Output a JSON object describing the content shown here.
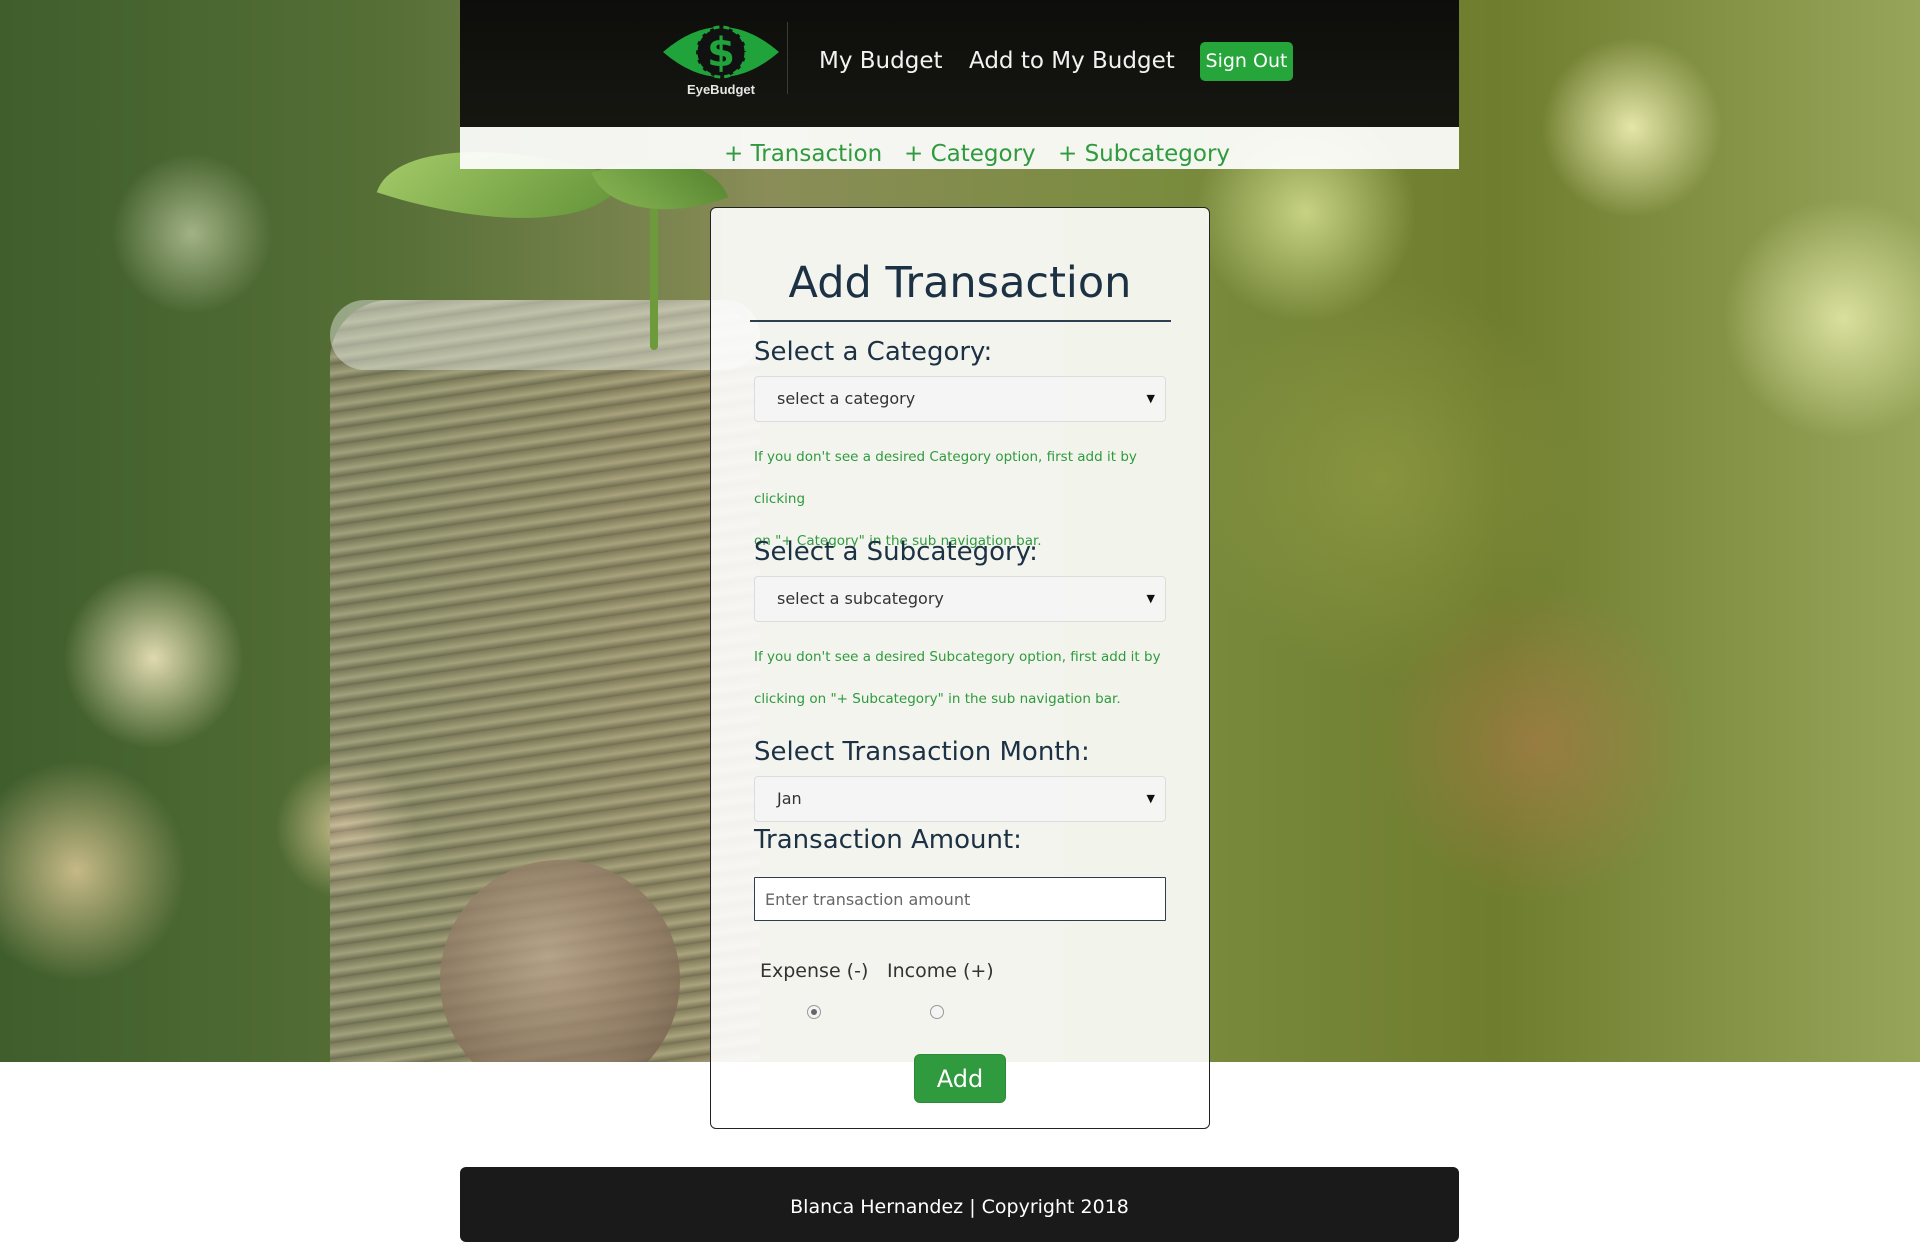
{
  "header": {
    "logo_text": "EyeBudget",
    "nav": {
      "my_budget": "My Budget",
      "add_to_budget": "Add to My Budget",
      "sign_out": "Sign Out"
    }
  },
  "subnav": {
    "transaction": "+ Transaction",
    "category": "+ Category",
    "subcategory": "+ Subcategory"
  },
  "form": {
    "title": "Add Transaction",
    "category_label": "Select a Category:",
    "category_selected": "select a category",
    "category_help_1": "If you don't see a desired Category option, first add it by clicking",
    "category_help_2": "on \"+ Category\" in the sub navigation bar.",
    "subcategory_label": "Select a Subcategory:",
    "subcategory_selected": "select a subcategory",
    "subcategory_help_1": "If you don't see a desired Subcategory option, first add it by",
    "subcategory_help_2": "clicking on \"+ Subcategory\" in the sub navigation bar.",
    "month_label": "Select Transaction Month:",
    "month_selected": "Jan",
    "amount_label": "Transaction Amount:",
    "amount_placeholder": "Enter transaction amount",
    "amount_value": "",
    "expense_label": "Expense (-)",
    "income_label": "Income (+)",
    "type_selected": "expense",
    "submit_label": "Add"
  },
  "footer": {
    "text": "Blanca Hernandez | Copyright 2018"
  },
  "colors": {
    "accent_green": "#2f9a3e",
    "header_bg": "#0d0d0b",
    "heading_navy": "#1c3144"
  },
  "icons": {
    "logo": "eye-dollar-icon",
    "dropdown": "caret-down-icon"
  }
}
